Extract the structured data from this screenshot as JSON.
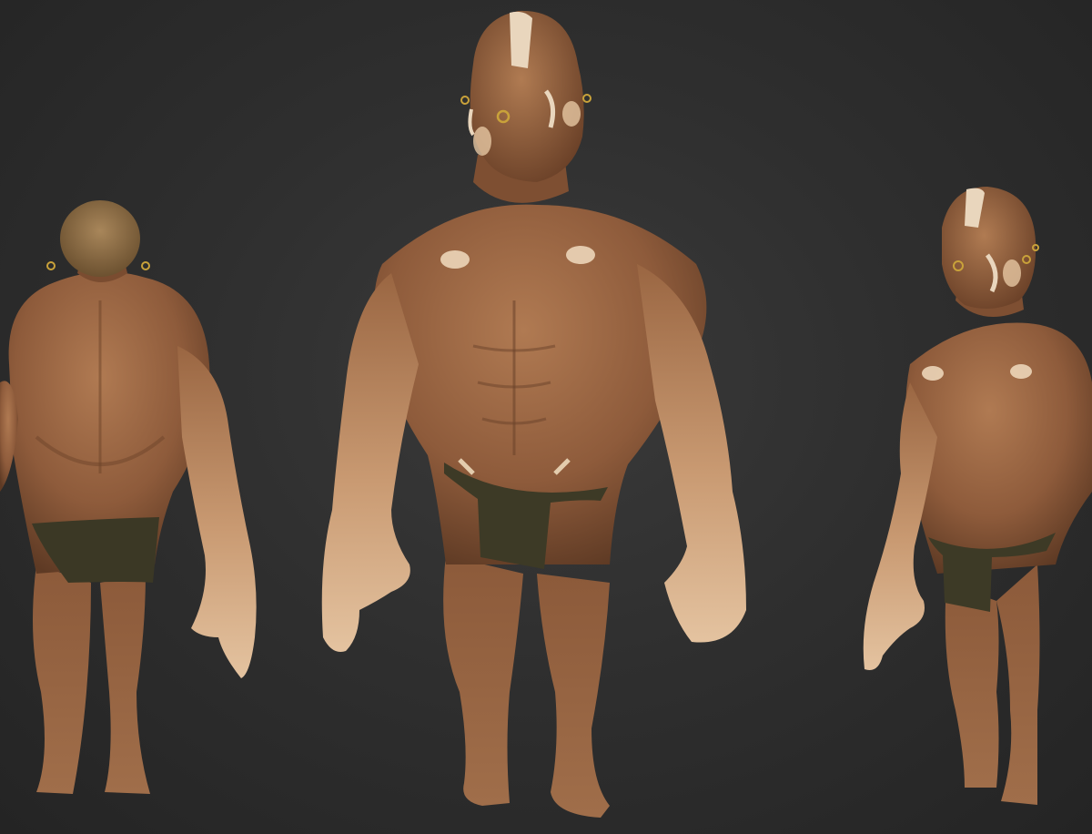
{
  "scene": {
    "background_color": "#2e2e2e",
    "skin_color": "#9a6642",
    "skin_highlight": "#e8c9a4",
    "loincloth_color": "#3d3a26",
    "paint_color": "#e9d6bd",
    "views": [
      {
        "name": "back-view"
      },
      {
        "name": "front-view"
      },
      {
        "name": "three-quarter-view"
      }
    ]
  }
}
